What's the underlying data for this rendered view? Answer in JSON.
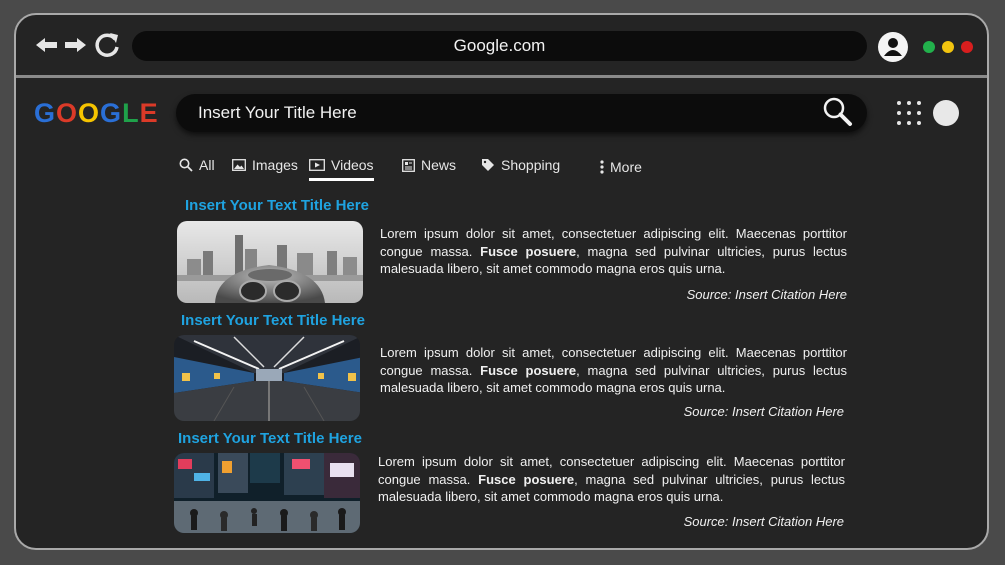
{
  "browser": {
    "url": "Google.com",
    "window_dots": [
      {
        "name": "green-dot",
        "color": "#22b14c"
      },
      {
        "name": "yellow-dot",
        "color": "#f2c40f"
      },
      {
        "name": "red-dot",
        "color": "#d81e1e"
      }
    ]
  },
  "logo": {
    "letters": [
      {
        "char": "G",
        "color": "#2a6fd6"
      },
      {
        "char": "O",
        "color": "#db3a28"
      },
      {
        "char": "O",
        "color": "#f6c400"
      },
      {
        "char": "G",
        "color": "#2a6fd6"
      },
      {
        "char": "L",
        "color": "#1fa14a"
      },
      {
        "char": "E",
        "color": "#db3a28"
      }
    ]
  },
  "search": {
    "query": "Insert Your Title Here"
  },
  "tabs": [
    {
      "label": "All",
      "icon": "search-icon"
    },
    {
      "label": "Images",
      "icon": "image-icon"
    },
    {
      "label": "Videos",
      "icon": "video-icon",
      "active": true
    },
    {
      "label": "News",
      "icon": "news-icon"
    },
    {
      "label": "Shopping",
      "icon": "tag-icon"
    },
    {
      "label": "More",
      "icon": "more-vert-icon"
    }
  ],
  "results": [
    {
      "title": "Insert Your Text Title Here",
      "snippet_before": "Lorem ipsum dolor sit amet, consectetuer adipiscing elit. Maecenas porttitor congue massa. ",
      "snippet_bold": "Fusce posuere",
      "snippet_after": ", magna sed pulvinar ultricies, purus lectus malesuada libero, sit amet commodo magna eros quis urna.",
      "source": "Source: Insert Citation Here",
      "image": "binoculars-city-photo"
    },
    {
      "title": "Insert Your Text Title Here",
      "snippet_before": "Lorem ipsum dolor sit amet, consectetuer adipiscing elit. Maecenas porttitor congue massa. ",
      "snippet_bold": "Fusce posuere",
      "snippet_after": ", magna sed pulvinar ultricies, purus lectus malesuada libero, sit amet commodo magna eros quis urna.",
      "source": "Source: Insert Citation Here",
      "image": "subway-station-photo"
    },
    {
      "title": "Insert Your Text Title Here",
      "snippet_before": "Lorem ipsum dolor sit amet, consectetuer adipiscing elit. Maecenas porttitor congue massa. ",
      "snippet_bold": "Fusce posuere",
      "snippet_after": ", magna sed pulvinar ultricies, purus lectus malesuada libero, sit amet commodo magna eros quis urna.",
      "source": "Source: Insert Citation Here",
      "image": "busy-street-photo"
    }
  ]
}
